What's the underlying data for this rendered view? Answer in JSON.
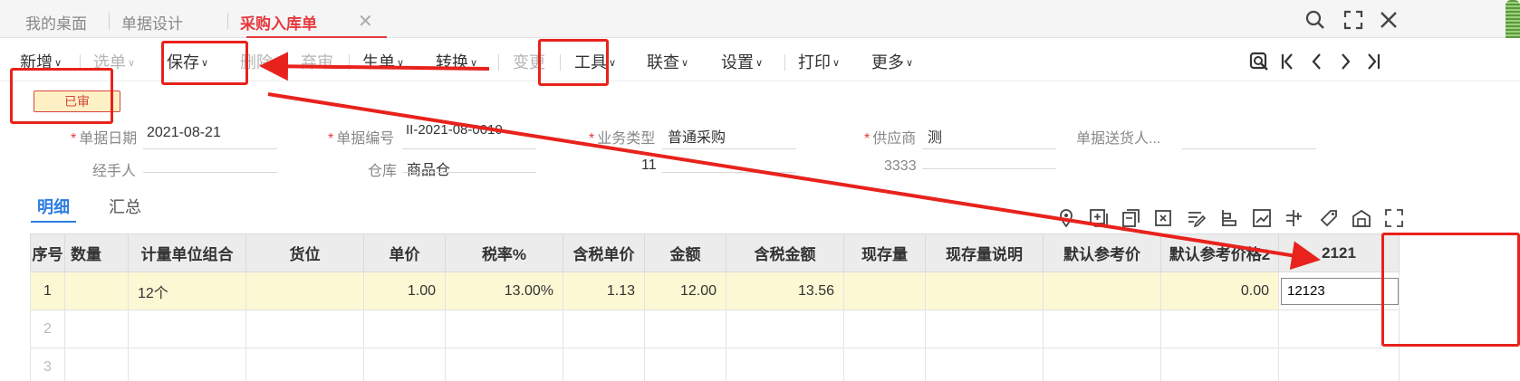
{
  "tabs": [
    {
      "label": "我的桌面"
    },
    {
      "label": "单据设计"
    },
    {
      "label": "采购入库单"
    }
  ],
  "toolbar": {
    "items": [
      {
        "label": "新增"
      },
      {
        "label": "选单"
      },
      {
        "label": "保存"
      },
      {
        "label": "删除"
      },
      {
        "label": "弃审"
      },
      {
        "label": "生单"
      },
      {
        "label": "转换"
      },
      {
        "label": "变更"
      },
      {
        "label": "工具"
      },
      {
        "label": "联查"
      },
      {
        "label": "设置"
      },
      {
        "label": "打印"
      },
      {
        "label": "更多"
      }
    ]
  },
  "status": {
    "label": "已审"
  },
  "form": {
    "date_label": "单据日期",
    "date_value": "2021-08-21",
    "code_label": "单据编号",
    "code_value": "II-2021-08-0010",
    "biztype_label": "业务类型",
    "biztype_value": "普通采购",
    "supplier_label": "供应商",
    "supplier_value": "测",
    "deliverer_label": "单据送货人...",
    "deliverer_value": "",
    "handler_label": "经手人",
    "handler_value": "",
    "warehouse_label": "仓库",
    "warehouse_value": "商品仓",
    "field11_value": "11",
    "field3333_label": "3333",
    "field3333_value": ""
  },
  "subtabs": [
    {
      "label": "明细"
    },
    {
      "label": "汇总"
    }
  ],
  "grid": {
    "headers": [
      "序号",
      "数量",
      "计量单位组合",
      "货位",
      "单价",
      "税率%",
      "含税单价",
      "金额",
      "含税金额",
      "现存量",
      "现存量说明",
      "默认参考价",
      "默认参考价格2",
      "2121"
    ],
    "row1": [
      "1",
      "",
      "12个",
      "",
      "1.00",
      "13.00%",
      "1.13",
      "12.00",
      "13.56",
      "",
      "",
      "",
      "0.00"
    ],
    "row1_edit_value": "12123",
    "row2_index": "2",
    "row3_index": "3"
  },
  "colors": {
    "accent_red": "#e5393e",
    "link_blue": "#2d7be0",
    "annotation_red": "#e8221c",
    "selected_row": "#fdf8d4"
  }
}
